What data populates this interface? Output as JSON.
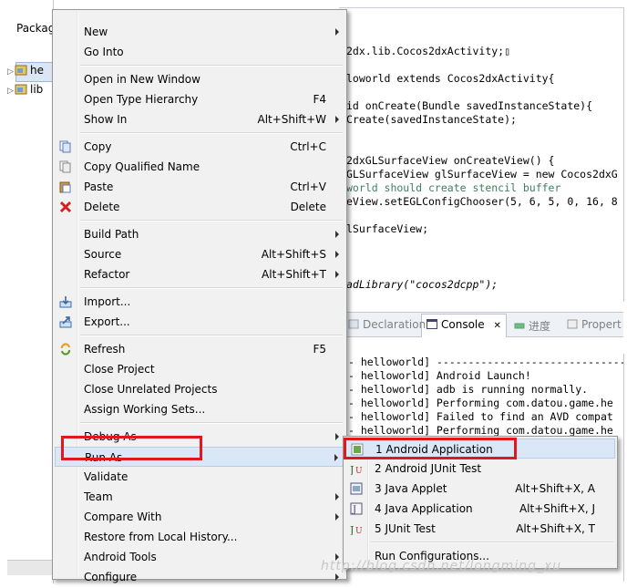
{
  "package_explorer": {
    "title": "Packag",
    "items": [
      {
        "label": "he"
      },
      {
        "label": "lib"
      }
    ]
  },
  "editor": {
    "lines": [
      "2dx.lib.Cocos2dxActivity;▯",
      "",
      "loworld extends Cocos2dxActivity{",
      "",
      "id onCreate(Bundle savedInstanceState){",
      "Create(savedInstanceState);",
      "",
      "",
      "2dxGLSurfaceView onCreateView() {",
      "GLSurfaceView glSurfaceView = new Cocos2dxG",
      "world should create stencil buffer",
      "eView.setEGLConfigChooser(5, 6, 5, 0, 16, 8",
      "",
      "lSurfaceView;",
      "",
      "",
      "",
      "adLibrary(\"cocos2dcpp\");"
    ]
  },
  "views": {
    "tabs": [
      {
        "label": "Declaration",
        "active": false
      },
      {
        "label": "Console",
        "active": true
      },
      {
        "label": "进度",
        "active": false
      },
      {
        "label": "Propert",
        "active": false
      }
    ],
    "close_glyph": "✕"
  },
  "console": {
    "lines": [
      "- helloworld] --------------------------------",
      "- helloworld] Android Launch!",
      "- helloworld] adb is running normally.",
      "- helloworld] Performing com.datou.game.he",
      "- helloworld] Failed to find an AVD compat",
      "- helloworld] Performing com.datou.game.he"
    ]
  },
  "context_menu": {
    "items": [
      {
        "label": "New",
        "shortcut": "",
        "submenu": true,
        "icon": ""
      },
      {
        "label": "Go Into",
        "shortcut": "",
        "submenu": false,
        "icon": ""
      },
      {
        "label": "Open in New Window",
        "shortcut": "",
        "submenu": false,
        "icon": ""
      },
      {
        "label": "Open Type Hierarchy",
        "shortcut": "F4",
        "submenu": false,
        "icon": ""
      },
      {
        "label": "Show In",
        "shortcut": "Alt+Shift+W",
        "submenu": true,
        "icon": ""
      },
      {
        "label": "Copy",
        "shortcut": "Ctrl+C",
        "submenu": false,
        "icon": "copy-icon"
      },
      {
        "label": "Copy Qualified Name",
        "shortcut": "",
        "submenu": false,
        "icon": "copy-qualified-icon"
      },
      {
        "label": "Paste",
        "shortcut": "Ctrl+V",
        "submenu": false,
        "icon": "paste-icon"
      },
      {
        "label": "Delete",
        "shortcut": "Delete",
        "submenu": false,
        "icon": "delete-icon"
      },
      {
        "label": "Build Path",
        "shortcut": "",
        "submenu": true,
        "icon": ""
      },
      {
        "label": "Source",
        "shortcut": "Alt+Shift+S",
        "submenu": true,
        "icon": ""
      },
      {
        "label": "Refactor",
        "shortcut": "Alt+Shift+T",
        "submenu": true,
        "icon": ""
      },
      {
        "label": "Import...",
        "shortcut": "",
        "submenu": false,
        "icon": "import-icon"
      },
      {
        "label": "Export...",
        "shortcut": "",
        "submenu": false,
        "icon": "export-icon"
      },
      {
        "label": "Refresh",
        "shortcut": "F5",
        "submenu": false,
        "icon": "refresh-icon"
      },
      {
        "label": "Close Project",
        "shortcut": "",
        "submenu": false,
        "icon": ""
      },
      {
        "label": "Close Unrelated Projects",
        "shortcut": "",
        "submenu": false,
        "icon": ""
      },
      {
        "label": "Assign Working Sets...",
        "shortcut": "",
        "submenu": false,
        "icon": ""
      },
      {
        "label": "Debug As",
        "shortcut": "",
        "submenu": true,
        "icon": ""
      },
      {
        "label": "Run As",
        "shortcut": "",
        "submenu": true,
        "icon": "",
        "highlighted": true
      },
      {
        "label": "Validate",
        "shortcut": "",
        "submenu": false,
        "icon": ""
      },
      {
        "label": "Team",
        "shortcut": "",
        "submenu": true,
        "icon": ""
      },
      {
        "label": "Compare With",
        "shortcut": "",
        "submenu": true,
        "icon": ""
      },
      {
        "label": "Restore from Local History...",
        "shortcut": "",
        "submenu": false,
        "icon": ""
      },
      {
        "label": "Android Tools",
        "shortcut": "",
        "submenu": true,
        "icon": ""
      },
      {
        "label": "Configure",
        "shortcut": "",
        "submenu": true,
        "icon": ""
      }
    ]
  },
  "run_as_submenu": {
    "items": [
      {
        "label": "1 Android Application",
        "shortcut": "",
        "icon": "android-app-icon",
        "highlighted": true
      },
      {
        "label": "2 Android JUnit Test",
        "shortcut": "",
        "icon": "junit-icon"
      },
      {
        "label": "3 Java Applet",
        "shortcut": "Alt+Shift+X, A",
        "icon": "java-applet-icon"
      },
      {
        "label": "4 Java Application",
        "shortcut": "Alt+Shift+X, J",
        "icon": "java-app-icon"
      },
      {
        "label": "5 JUnit Test",
        "shortcut": "Alt+Shift+X, T",
        "icon": "junit-icon"
      },
      {
        "label": "Run Configurations...",
        "shortcut": "",
        "icon": ""
      }
    ]
  },
  "annotation_color": "#e0181e",
  "watermark": "http://blog.csdn.net/longming_xu"
}
